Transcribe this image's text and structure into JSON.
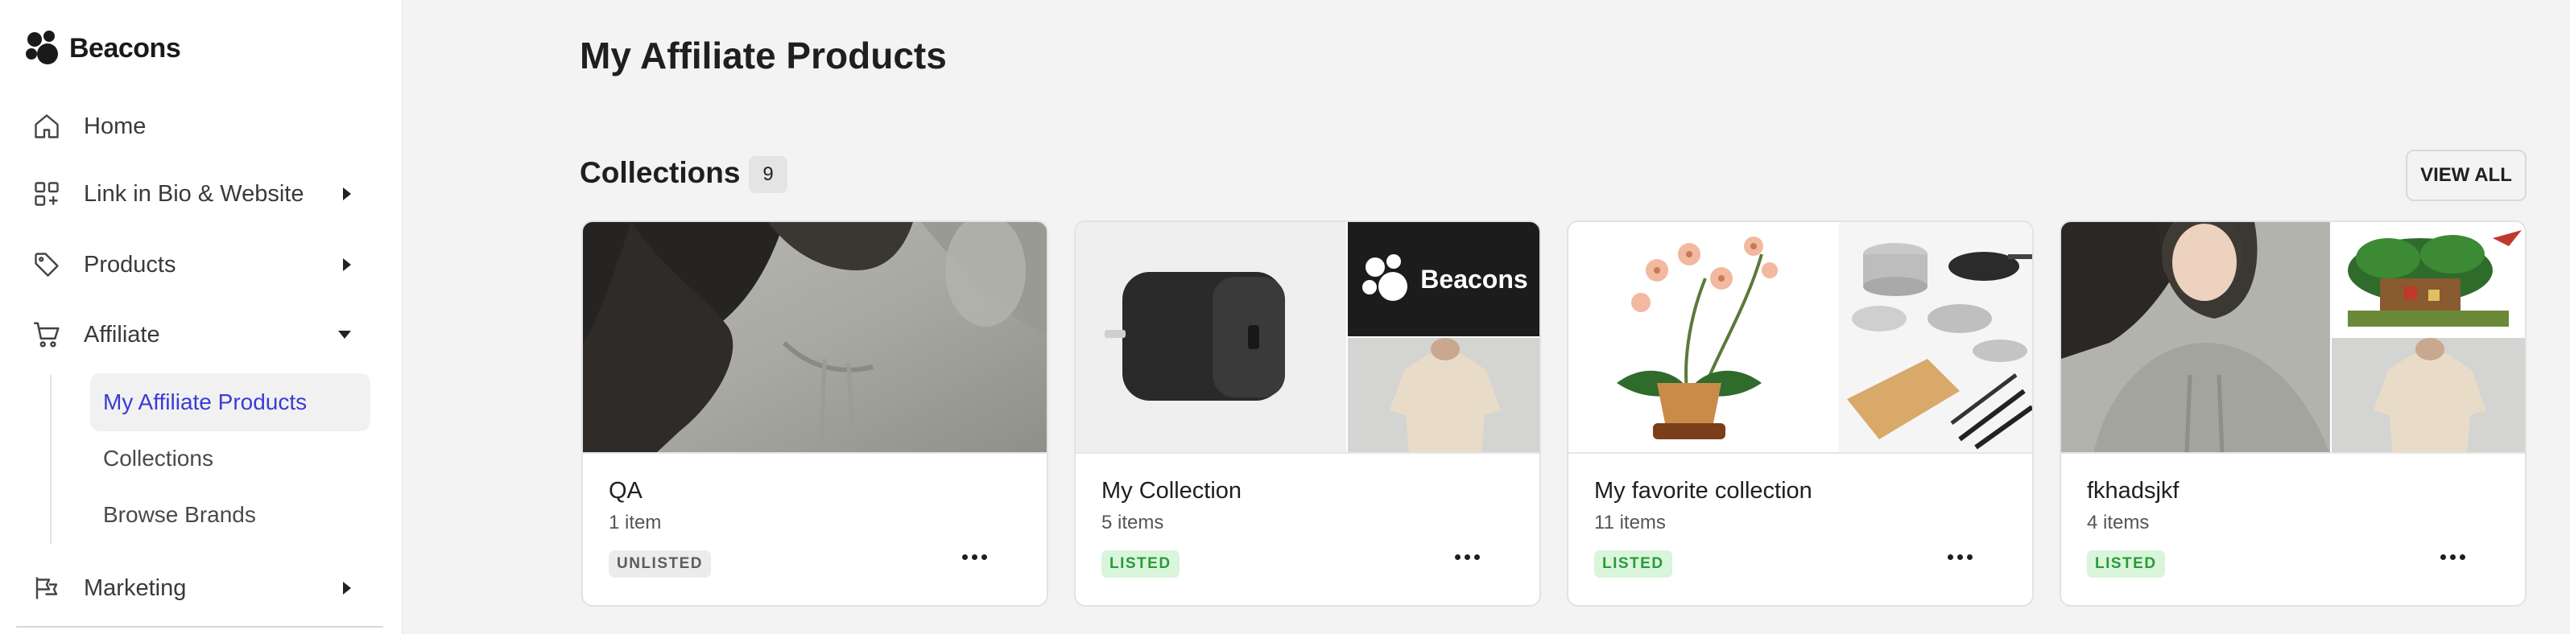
{
  "app": {
    "logo_text": "Beacons"
  },
  "sidebar": {
    "items": [
      {
        "label": "Home",
        "icon": "home-icon"
      },
      {
        "label": "Link in Bio & Website",
        "icon": "grid-plus-icon"
      },
      {
        "label": "Products",
        "icon": "tag-icon"
      },
      {
        "label": "Affiliate",
        "icon": "cart-icon"
      },
      {
        "label": "Marketing",
        "icon": "megaphone-icon"
      }
    ],
    "affiliate_subitems": [
      {
        "label": "My Affiliate Products",
        "active": true
      },
      {
        "label": "Collections",
        "active": false
      },
      {
        "label": "Browse Brands",
        "active": false
      }
    ]
  },
  "main": {
    "page_title": "My Affiliate Products",
    "collections": {
      "title": "Collections",
      "count": "9",
      "view_all_label": "VIEW ALL",
      "cards": [
        {
          "title": "QA",
          "count": "1 item",
          "status": "UNLISTED"
        },
        {
          "title": "My Collection",
          "count": "5 items",
          "status": "LISTED",
          "media_logo_text": "Beacons"
        },
        {
          "title": "My favorite collection",
          "count": "11 items",
          "status": "LISTED"
        },
        {
          "title": "fkhadsjkf",
          "count": "4 items",
          "status": "LISTED"
        }
      ]
    }
  },
  "colors": {
    "active_nav_text": "#3b3bd6",
    "listed_badge_bg": "#d9f5db",
    "listed_badge_text": "#2a9a3a",
    "unlisted_badge_bg": "#ececec"
  }
}
